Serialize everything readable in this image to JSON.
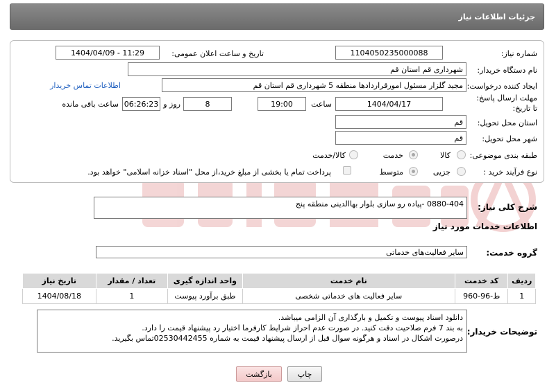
{
  "header": {
    "title": "جزئیات اطلاعات نیاز"
  },
  "labels": {
    "need_number": "شماره نیاز:",
    "announce_datetime": "تاریخ و ساعت اعلان عمومی:",
    "buyer_org": "نام دستگاه خریدار:",
    "requester": "ایجاد کننده درخواست:",
    "buyer_contact": "اطلاعات تماس خریدار",
    "deadline": "مهلت ارسال پاسخ: تا تاریخ:",
    "time_word": "ساعت",
    "day_and": "روز و",
    "remaining": "ساعت باقی مانده",
    "province": "استان محل تحویل:",
    "city": "شهر محل تحویل:",
    "category": "طبقه بندی موضوعی:",
    "purchase_type": "نوع فرآیند خرید :",
    "general_desc": "شرح کلی نیاز:",
    "services_info": "اطلاعات خدمات مورد نیاز",
    "service_group": "گروه خدمت:",
    "buyer_notes": "توضیحات خریدار:"
  },
  "fields": {
    "need_number": "1104050235000088",
    "announce_datetime": "1404/04/09 - 11:29",
    "buyer_org": "شهرداری قم استان قم",
    "requester": "مجید گلزار مسئول امورقراردادها منطقه 5 شهرداری قم استان قم",
    "deadline_date": "1404/04/17",
    "deadline_time": "19:00",
    "days": "8",
    "remaining_time": "06:26:23",
    "province": "قم",
    "city": "قم",
    "general_desc": "0880-404 -پیاده رو سازی بلوار بهاالدینی منطقه پنج",
    "service_group": "سایر فعالیت‌های خدماتی"
  },
  "category_options": {
    "goods": "کالا",
    "service": "خدمت",
    "goods_service": "کالا/خدمت",
    "selected": "خدمت"
  },
  "purchase_options": {
    "partial": "جزیی",
    "medium": "متوسط",
    "selected": "متوسط",
    "payment_note": "پرداخت تمام یا بخشی از مبلغ خرید،از محل \"اسناد خزانه اسلامی\" خواهد بود."
  },
  "table": {
    "headers": [
      "ردیف",
      "کد خدمت",
      "نام خدمت",
      "واحد اندازه گیری",
      "تعداد / مقدار",
      "تاریخ نیاز"
    ],
    "rows": [
      [
        "1",
        "ط-96-960",
        "سایر فعالیت های خدماتی شخصی",
        "طبق برآورد پیوست",
        "1",
        "1404/08/18"
      ]
    ]
  },
  "notes": [
    "دانلود اسناد پیوست و تکمیل و بارگذاری آن الزامی میباشد.",
    "به بند 7 فرم صلاحیت دقت کنید. در صورت عدم احراز شرایط کارفرما اختیار رد پیشنهاد قیمت را دارد.",
    "درصورت اشکال در اسناد و هرگونه سوال قبل از ارسال پیشنهاد قیمت به شماره 02530442455تماس بگیرید."
  ],
  "buttons": {
    "print": "چاپ",
    "back": "بازگشت"
  },
  "colors": {
    "header_bg": "#7a7a7a",
    "link": "#1f5fbf",
    "back_button": "#f3c9c9",
    "watermark": "#e7b3b3"
  }
}
